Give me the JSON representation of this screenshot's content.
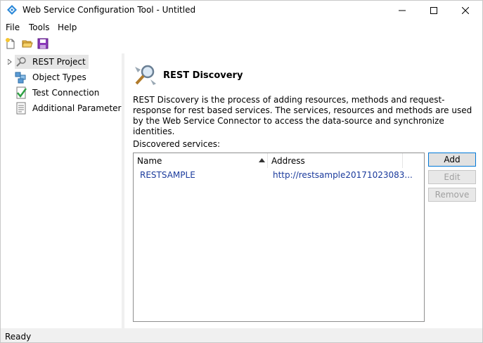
{
  "window": {
    "title": "Web Service Configuration Tool - Untitled"
  },
  "menu": {
    "file": "File",
    "tools": "Tools",
    "help": "Help"
  },
  "tree": {
    "items": [
      {
        "label": "REST Project",
        "icon": "rest-project-icon"
      },
      {
        "label": "Object Types",
        "icon": "object-types-icon"
      },
      {
        "label": "Test Connection",
        "icon": "test-connection-icon"
      },
      {
        "label": "Additional Parameters",
        "icon": "additional-parameters-icon"
      }
    ]
  },
  "content": {
    "title": "REST Discovery",
    "description": "REST Discovery is the process of adding resources, methods and request-response for rest based services. The services, resources and methods are used by the Web Service Connector to access the data-source and synchronize identities.",
    "discovered_label": "Discovered services:",
    "columns": {
      "name": "Name",
      "address": "Address"
    },
    "rows": [
      {
        "name": "RESTSAMPLE",
        "address": "http://restsample20171023083..."
      }
    ],
    "buttons": {
      "add": "Add",
      "edit": "Edit",
      "remove": "Remove"
    }
  },
  "status": {
    "text": "Ready"
  },
  "colors": {
    "accent": "#0078d7",
    "link": "#1a3a9c"
  }
}
